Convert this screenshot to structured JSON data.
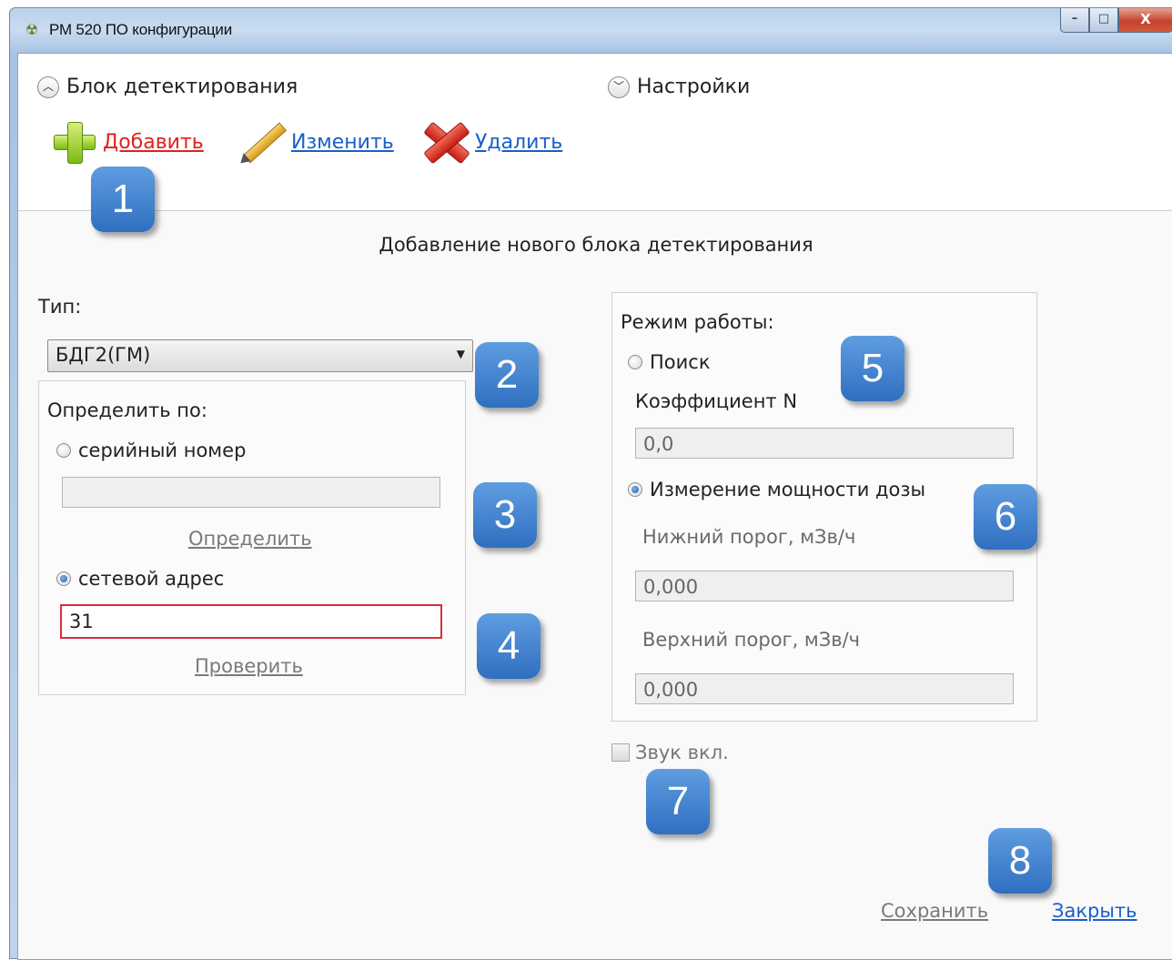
{
  "window": {
    "title": "РМ 520 ПО конфигурации",
    "buttons": {
      "minimize": "–",
      "maximize": "□",
      "close": "X"
    }
  },
  "expanders": {
    "detection_block": "Блок детектирования",
    "settings": "Настройки"
  },
  "toolbar": {
    "add_label": "Добавить",
    "edit_label": "Изменить",
    "delete_label": "Удалить"
  },
  "form": {
    "title": "Добавление нового блока детектирования",
    "type_label": "Тип:",
    "type_value": "БДГ2(ГМ)",
    "identify_by_label": "Определить по:",
    "serial_radio_label": "серийный номер",
    "serial_value": "",
    "identify_link": "Определить",
    "network_radio_label": "сетевой адрес",
    "network_value": "31",
    "check_link": "Проверить",
    "mode_label": "Режим работы:",
    "search_radio_label": "Поиск",
    "coef_label": "Коэффициент N",
    "coef_value": "0,0",
    "dose_radio_label": "Измерение мощности дозы",
    "lower_threshold_label": "Нижний порог, мЗв/ч",
    "lower_threshold_value": "0,000",
    "upper_threshold_label": "Верхний порог, мЗв/ч",
    "upper_threshold_value": "0,000",
    "sound_label": "Звук вкл.",
    "sound_checked": false,
    "save_link": "Сохранить",
    "close_link": "Закрыть"
  },
  "badges": [
    "1",
    "2",
    "3",
    "4",
    "5",
    "6",
    "7",
    "8"
  ],
  "colors": {
    "badge": "#3d7fd0",
    "add_link": "#e02020",
    "link": "#1a5fc8",
    "active_border": "#d8303c"
  }
}
